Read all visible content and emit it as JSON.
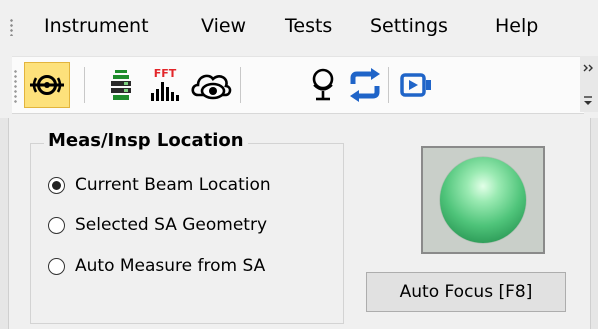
{
  "menubar": {
    "items": [
      {
        "label": "Instrument"
      },
      {
        "label": "View"
      },
      {
        "label": "Tests"
      },
      {
        "label": "Settings"
      },
      {
        "label": "Help"
      }
    ]
  },
  "toolbar": {
    "buttons": [
      {
        "icon": "target-probe-icon",
        "active": true
      },
      {
        "icon": "instrument-tower-icon",
        "active": false
      },
      {
        "icon": "fft-spectrum-icon",
        "text": "FFT",
        "active": false
      },
      {
        "icon": "cloud-eye-icon",
        "active": false
      },
      {
        "icon": "microphone-icon",
        "active": false
      },
      {
        "icon": "refresh-icon",
        "active": false
      },
      {
        "icon": "video-camera-icon",
        "active": false
      }
    ]
  },
  "location_group": {
    "title": "Meas/Insp Location",
    "options": [
      {
        "label": "Current Beam Location",
        "selected": true
      },
      {
        "label": "Selected SA Geometry",
        "selected": false
      },
      {
        "label": "Auto Measure from SA",
        "selected": false
      }
    ]
  },
  "focus": {
    "indicator_color": "#4fc47a",
    "button_label": "Auto Focus [F8]"
  },
  "colors": {
    "active_tool_bg": "#fde17b",
    "fft_red": "#e3262a",
    "blue_accent": "#1f64c8",
    "green_accent": "#1e8c2c"
  }
}
